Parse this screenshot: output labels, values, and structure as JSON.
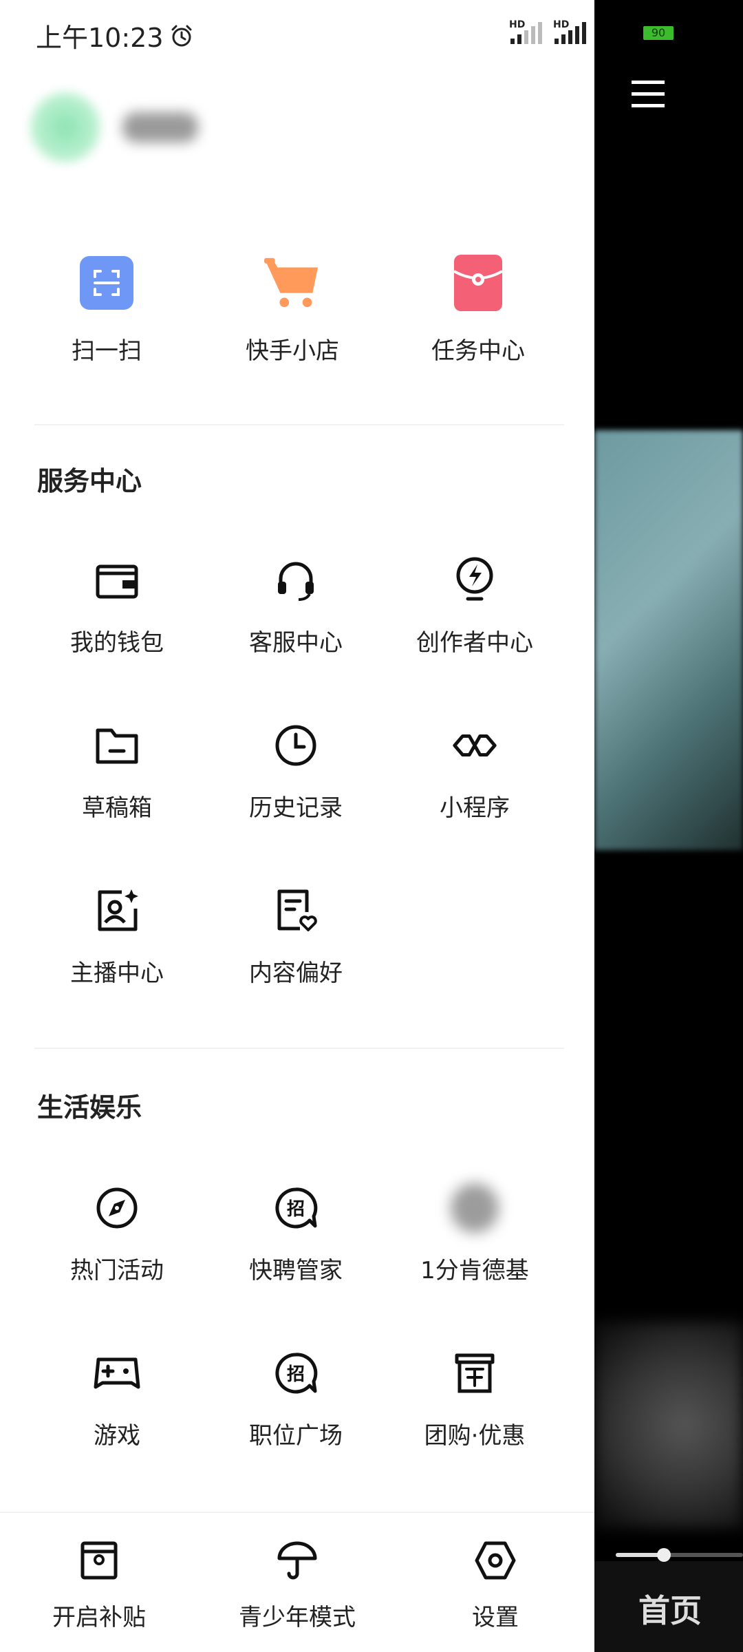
{
  "status_bar": {
    "time": "上午10:23",
    "network_label": "HD",
    "battery": "90"
  },
  "top_shortcuts": [
    {
      "label": "扫一扫",
      "icon": "scan-icon",
      "color": "#6f97f5"
    },
    {
      "label": "快手小店",
      "icon": "cart-icon",
      "color": "#ff9a5a"
    },
    {
      "label": "任务中心",
      "icon": "red-envelope-icon",
      "color": "#f46075"
    }
  ],
  "service_center": {
    "title": "服务中心",
    "items": [
      {
        "label": "我的钱包",
        "icon": "wallet-icon"
      },
      {
        "label": "客服中心",
        "icon": "headset-icon"
      },
      {
        "label": "创作者中心",
        "icon": "lightning-bulb-icon"
      },
      {
        "label": "草稿箱",
        "icon": "folder-icon"
      },
      {
        "label": "历史记录",
        "icon": "clock-icon"
      },
      {
        "label": "小程序",
        "icon": "infinity-icon"
      },
      {
        "label": "主播中心",
        "icon": "streamer-icon"
      },
      {
        "label": "内容偏好",
        "icon": "document-heart-icon"
      }
    ]
  },
  "life_entertainment": {
    "title": "生活娱乐",
    "items": [
      {
        "label": "热门活动",
        "icon": "compass-icon"
      },
      {
        "label": "快聘管家",
        "icon": "recruit-icon"
      },
      {
        "label": "1分肯德基",
        "icon": "blurred-icon"
      },
      {
        "label": "游戏",
        "icon": "gamepad-icon"
      },
      {
        "label": "职位广场",
        "icon": "recruit-icon"
      },
      {
        "label": "团购·优惠",
        "icon": "store-icon"
      }
    ]
  },
  "bottom_bar": [
    {
      "label": "开启补贴",
      "icon": "subsidy-icon"
    },
    {
      "label": "青少年模式",
      "icon": "umbrella-icon"
    },
    {
      "label": "设置",
      "icon": "settings-hexagon-icon"
    }
  ],
  "background": {
    "home_tab_label": "首页",
    "video_progress": 0.38
  }
}
